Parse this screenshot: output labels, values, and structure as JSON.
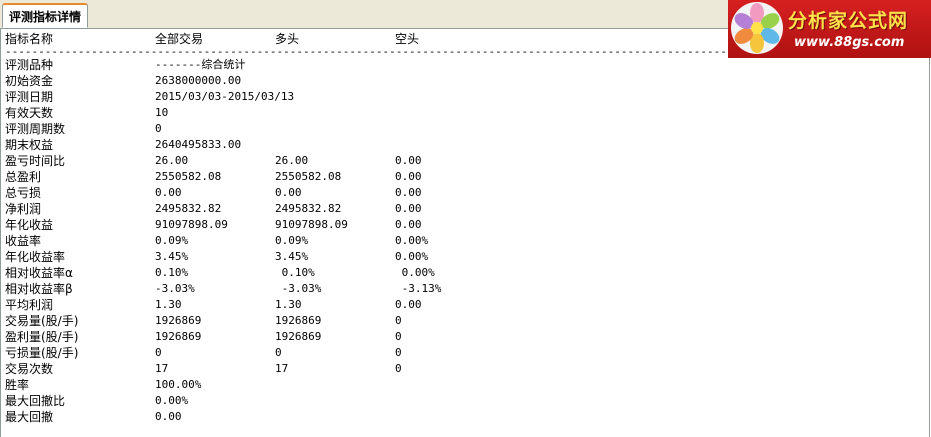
{
  "tab": {
    "label": "评测指标详情"
  },
  "logo": {
    "title": "分析家公式网",
    "url": "www.88gs.com"
  },
  "table": {
    "columns": [
      "指标名称",
      "全部交易",
      "多头",
      "空头"
    ],
    "separator": "--------------------------------------------------------------------------------------------------------------------------------------------",
    "rows": [
      {
        "name": "评测品种",
        "all": "-------综合统计",
        "long": "",
        "short": ""
      },
      {
        "name": "初始资金",
        "all": "2638000000.00",
        "long": "",
        "short": ""
      },
      {
        "name": "评测日期",
        "all": "2015/03/03-2015/03/13",
        "long": "",
        "short": ""
      },
      {
        "name": "有效天数",
        "all": "10",
        "long": "",
        "short": ""
      },
      {
        "name": "评测周期数",
        "all": "0",
        "long": "",
        "short": ""
      },
      {
        "name": "期末权益",
        "all": "2640495833.00",
        "long": "",
        "short": ""
      },
      {
        "name": "盈亏时间比",
        "all": "26.00",
        "long": "26.00",
        "short": "0.00"
      },
      {
        "name": "总盈利",
        "all": "2550582.08",
        "long": "2550582.08",
        "short": "0.00"
      },
      {
        "name": "总亏损",
        "all": "0.00",
        "long": "0.00",
        "short": "0.00"
      },
      {
        "name": "净利润",
        "all": "2495832.82",
        "long": "2495832.82",
        "short": "0.00"
      },
      {
        "name": "年化收益",
        "all": "91097898.09",
        "long": "91097898.09",
        "short": "0.00"
      },
      {
        "name": "收益率",
        "all": "0.09%",
        "long": "0.09%",
        "short": "0.00%"
      },
      {
        "name": "年化收益率",
        "all": "3.45%",
        "long": "3.45%",
        "short": "0.00%"
      },
      {
        "name": "相对收益率α",
        "all": "0.10%",
        "long": " 0.10%",
        "short": " 0.00%"
      },
      {
        "name": "相对收益率β",
        "all": "-3.03%",
        "long": " -3.03%",
        "short": " -3.13%"
      },
      {
        "name": "平均利润",
        "all": "1.30",
        "long": "1.30",
        "short": "0.00"
      },
      {
        "name": "交易量(股/手)",
        "all": "1926869",
        "long": "1926869",
        "short": "0"
      },
      {
        "name": "盈利量(股/手)",
        "all": "1926869",
        "long": "1926869",
        "short": "0"
      },
      {
        "name": "亏损量(股/手)",
        "all": "0",
        "long": "0",
        "short": "0"
      },
      {
        "name": "交易次数",
        "all": "17",
        "long": "17",
        "short": "0"
      },
      {
        "name": "胜率",
        "all": "100.00%",
        "long": "",
        "short": ""
      },
      {
        "name": "最大回撤比",
        "all": "0.00%",
        "long": "",
        "short": ""
      },
      {
        "name": "最大回撤",
        "all": "0.00",
        "long": "",
        "short": ""
      }
    ]
  }
}
